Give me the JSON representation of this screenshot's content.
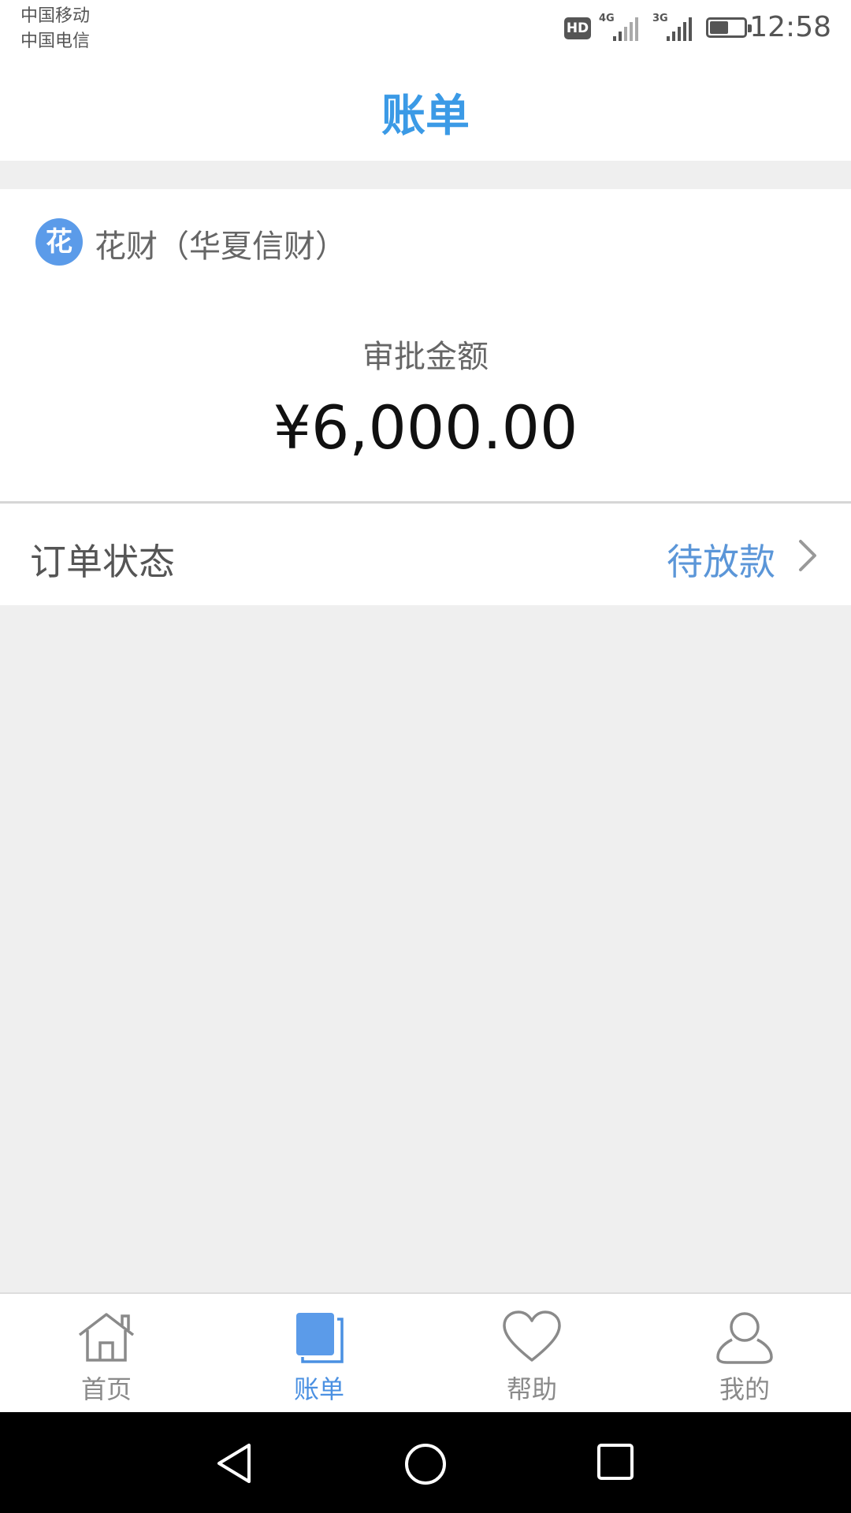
{
  "status_bar": {
    "carrier_1": "中国移动",
    "carrier_2": "中国电信",
    "hd": "HD",
    "network_1": "4G",
    "network_2": "3G",
    "battery_level": 0.55,
    "time": "12:58"
  },
  "header": {
    "title": "账单"
  },
  "loan_card": {
    "provider_badge": "花",
    "provider_name": "花财（华夏信财）",
    "amount_label": "审批金额",
    "amount_value": "¥6,000.00"
  },
  "order_status": {
    "label": "订单状态",
    "value": "待放款"
  },
  "tab_bar": {
    "active": "bills",
    "tabs": [
      {
        "id": "home",
        "label": "首页",
        "icon": "home-icon"
      },
      {
        "id": "bills",
        "label": "账单",
        "icon": "bill-icon"
      },
      {
        "id": "help",
        "label": "帮助",
        "icon": "heart-icon"
      },
      {
        "id": "mine",
        "label": "我的",
        "icon": "user-icon"
      }
    ]
  },
  "colors": {
    "accent": "#3b9ae6",
    "status_value": "#5b96d8",
    "badge": "#5b9be9",
    "background": "#efefef"
  }
}
